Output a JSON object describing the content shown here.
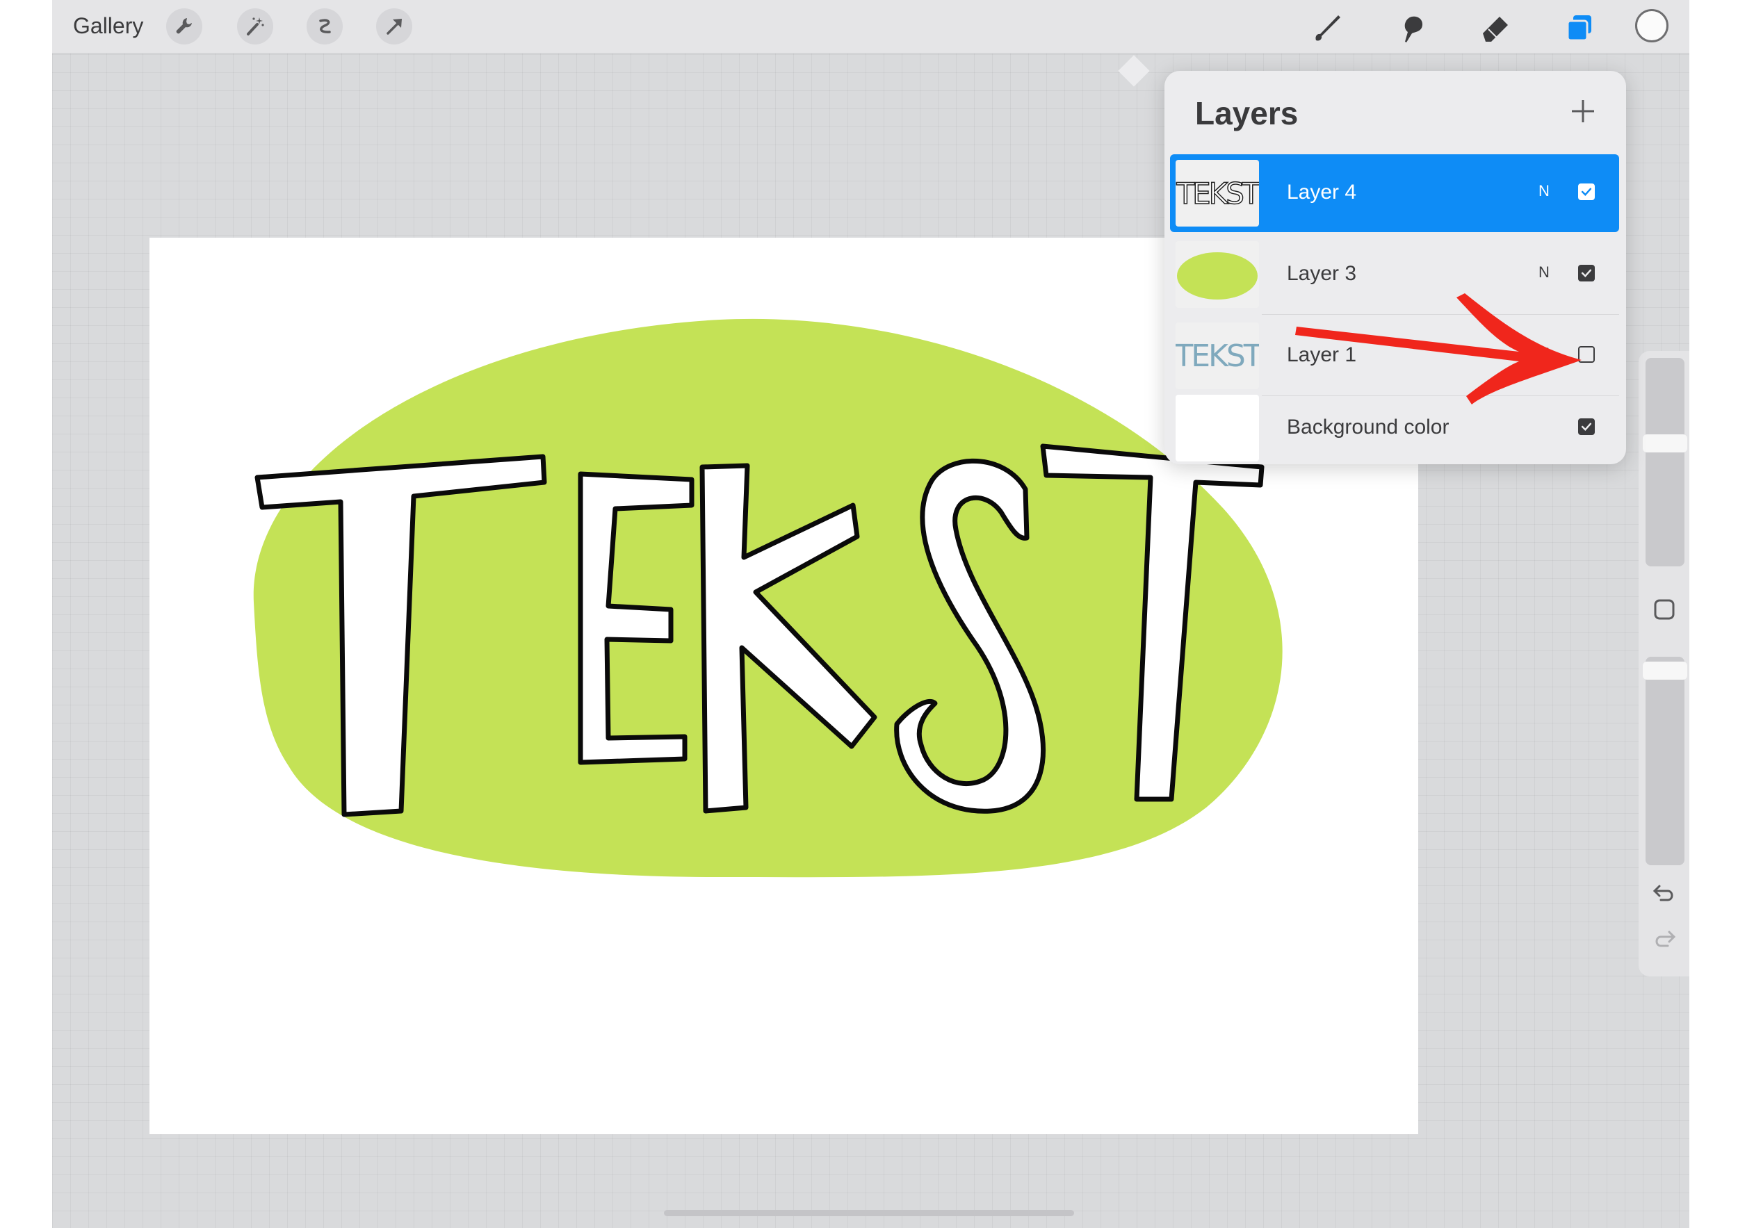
{
  "topbar": {
    "gallery_label": "Gallery",
    "left_tools": [
      "wrench-icon",
      "magic-wand-icon",
      "selection-icon",
      "transform-arrow-icon"
    ],
    "right_tools": [
      "brush-icon",
      "smudge-icon",
      "eraser-icon",
      "layers-icon"
    ],
    "accent_color": "#0e8cf6",
    "active_color": "#ffffff"
  },
  "canvas": {
    "artwork_text": "TEKST",
    "blob_color": "#c4e256"
  },
  "layers_panel": {
    "title": "Layers",
    "layers": [
      {
        "name": "Layer 4",
        "blend": "N",
        "visible": true,
        "selected": true,
        "thumb_text": "TEKST"
      },
      {
        "name": "Layer 3",
        "blend": "N",
        "visible": true,
        "selected": false
      },
      {
        "name": "Layer 1",
        "blend": "N",
        "visible": false,
        "selected": false,
        "thumb_text": "TEKST"
      },
      {
        "name": "Background color",
        "blend": "",
        "visible": true,
        "selected": false
      }
    ]
  },
  "annotation": {
    "color": "#f0261c"
  }
}
